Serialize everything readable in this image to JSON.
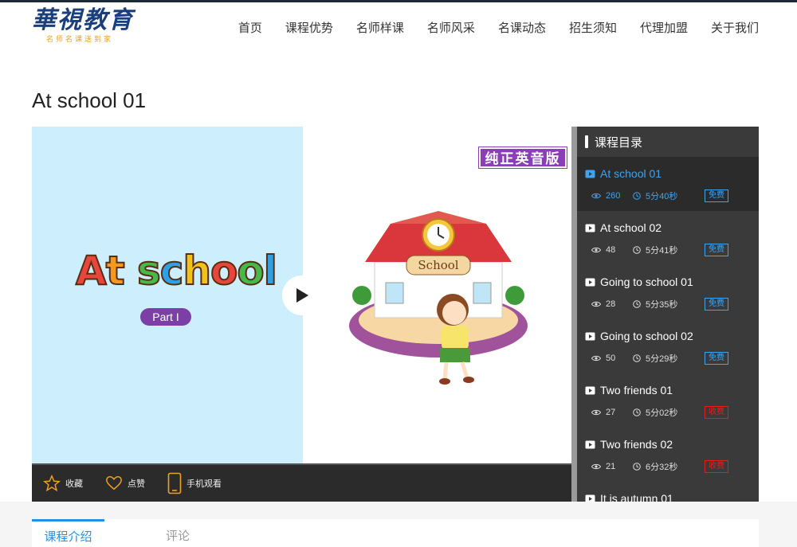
{
  "header": {
    "logo_main": "華視教育",
    "logo_sub": "名师名课送到家",
    "nav": [
      "首页",
      "课程优势",
      "名师样课",
      "名师风采",
      "名课动态",
      "招生须知",
      "代理加盟",
      "关于我们"
    ]
  },
  "page": {
    "title": "At school 01"
  },
  "video": {
    "title_art": "At school",
    "part_label": "Part I",
    "badge": "纯正英音版",
    "sign_text": "School"
  },
  "player_bar": {
    "favorite": "收藏",
    "like": "点赞",
    "mobile": "手机观看"
  },
  "catalog": {
    "heading": "课程目录",
    "lessons": [
      {
        "title": "At school 01",
        "views": "260",
        "duration": "5分40秒",
        "tag": "免费",
        "paid": false,
        "active": true
      },
      {
        "title": "At school 02",
        "views": "48",
        "duration": "5分41秒",
        "tag": "免费",
        "paid": false,
        "active": false
      },
      {
        "title": "Going to school 01",
        "views": "28",
        "duration": "5分35秒",
        "tag": "免费",
        "paid": false,
        "active": false
      },
      {
        "title": "Going to school 02",
        "views": "50",
        "duration": "5分29秒",
        "tag": "免费",
        "paid": false,
        "active": false
      },
      {
        "title": "Two friends 01",
        "views": "27",
        "duration": "5分02秒",
        "tag": "收费",
        "paid": true,
        "active": false
      },
      {
        "title": "Two friends 02",
        "views": "21",
        "duration": "6分32秒",
        "tag": "收费",
        "paid": true,
        "active": false
      },
      {
        "title": "It is autumn 01",
        "views": "",
        "duration": "",
        "tag": "",
        "paid": false,
        "active": false
      }
    ]
  },
  "tabs": {
    "intro": "课程介绍",
    "comments": "评论"
  },
  "colors": {
    "accent": "#1e90e8",
    "paid": "#e02020",
    "badge": "#8a3fb8"
  }
}
